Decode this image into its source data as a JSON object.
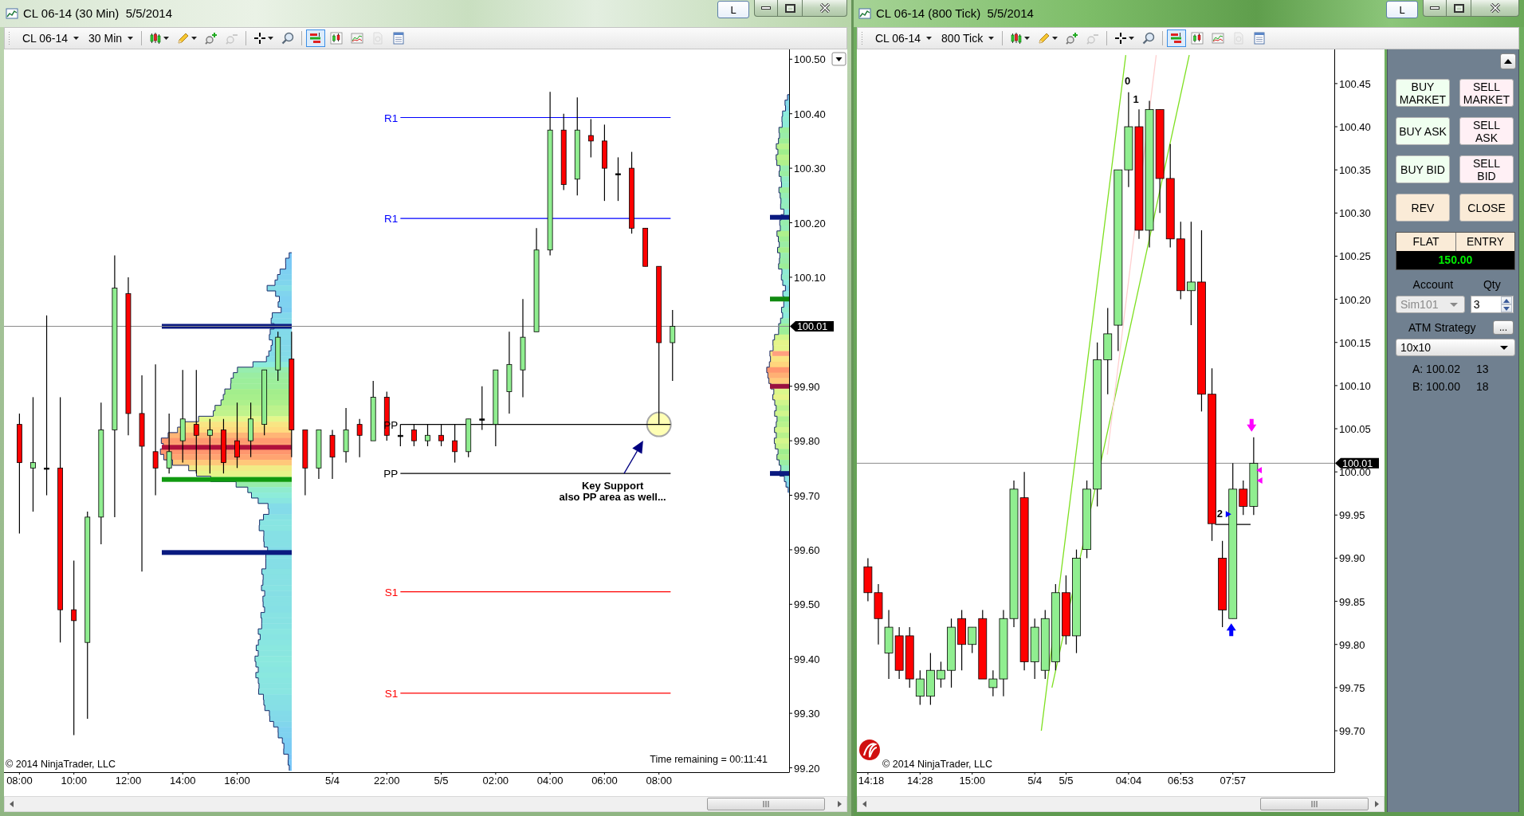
{
  "windows": [
    {
      "title": "CL 06-14 (30 Min)  5/5/2014",
      "link_button": "L",
      "toolbar": {
        "instrument": "CL 06-14",
        "interval": "30 Min",
        "tool_groups": [
          [
            {
              "kind": "bar-type",
              "dropdown": true,
              "selected": false,
              "disabled": false
            },
            {
              "kind": "draw",
              "dropdown": true,
              "selected": false,
              "disabled": false
            },
            {
              "kind": "zoom-in",
              "dropdown": false,
              "selected": false,
              "disabled": false
            },
            {
              "kind": "zoom-out",
              "dropdown": false,
              "selected": false,
              "disabled": true
            }
          ],
          [
            {
              "kind": "crosshair",
              "dropdown": true,
              "selected": false,
              "disabled": false
            },
            {
              "kind": "magnifier",
              "dropdown": false,
              "selected": false,
              "disabled": false
            }
          ],
          [
            {
              "kind": "chart-trader",
              "dropdown": false,
              "selected": true,
              "disabled": false
            },
            {
              "kind": "indicators",
              "dropdown": false,
              "selected": false,
              "disabled": false
            },
            {
              "kind": "strategies",
              "dropdown": false,
              "selected": false,
              "disabled": false
            },
            {
              "kind": "page",
              "dropdown": false,
              "selected": false,
              "disabled": true
            },
            {
              "kind": "properties",
              "dropdown": false,
              "selected": false,
              "disabled": false
            }
          ]
        ]
      },
      "chart": {
        "volume_profile": true,
        "mini_profile": true,
        "axis_menu_button": true,
        "last_price": "100.01",
        "copyright": {
          "text": "© 2014 NinjaTrader, LLC"
        },
        "time_remaining": "Time remaining = 00:11:41",
        "drawings": [
          {
            "kind": "circle"
          },
          {
            "kind": "arrow"
          }
        ],
        "chart_data": {
          "type": "candlestick",
          "categories": [
            "08:00",
            null,
            null,
            null,
            "10:00",
            null,
            null,
            null,
            "12:00",
            null,
            null,
            null,
            "14:00",
            null,
            null,
            null,
            "16:00",
            null,
            null,
            null,
            null,
            null,
            null,
            "5/4",
            null,
            null,
            null,
            "22:00",
            null,
            null,
            null,
            "5/5",
            null,
            null,
            null,
            "02:00",
            null,
            null,
            null,
            "04:00",
            null,
            null,
            null,
            "06:00",
            null,
            null,
            null,
            "08:00",
            null,
            null,
            null,
            null,
            null,
            null,
            null,
            null,
            null
          ],
          "ylim": [
            99.192,
            100.518
          ],
          "yticks": [
            {
              "value": 100.5,
              "label": "100.50"
            },
            {
              "value": 100.4,
              "label": "100.40"
            },
            {
              "value": 100.3,
              "label": "100.30"
            },
            {
              "value": 100.2,
              "label": "100.20"
            },
            {
              "value": 100.1,
              "label": "100.10"
            },
            {
              "value": 99.9,
              "label": "99.90"
            },
            {
              "value": 99.8,
              "label": "99.80"
            },
            {
              "value": 99.7,
              "label": "99.70"
            },
            {
              "value": 99.6,
              "label": "99.60"
            },
            {
              "value": 99.5,
              "label": "99.50"
            },
            {
              "value": 99.4,
              "label": "99.40"
            },
            {
              "value": 99.3,
              "label": "99.30"
            },
            {
              "value": 99.2,
              "label": "99.20"
            }
          ],
          "ohlc": [
            [
              99.83,
              99.85,
              99.63,
              99.76
            ],
            [
              99.75,
              99.88,
              99.67,
              99.76
            ],
            [
              99.75,
              100.03,
              99.7,
              99.75
            ],
            [
              99.75,
              99.88,
              99.43,
              99.49
            ],
            [
              99.49,
              99.58,
              99.26,
              99.47
            ],
            [
              99.43,
              99.67,
              99.29,
              99.66
            ],
            [
              99.66,
              99.87,
              99.61,
              99.82
            ],
            [
              99.82,
              100.14,
              99.66,
              100.08
            ],
            [
              100.07,
              100.1,
              99.81,
              99.85
            ],
            [
              99.85,
              99.92,
              99.56,
              99.79
            ],
            [
              99.78,
              99.94,
              99.7,
              99.75
            ],
            [
              99.75,
              99.85,
              99.74,
              99.78
            ],
            [
              99.8,
              99.93,
              99.76,
              99.84
            ],
            [
              99.83,
              99.93,
              99.74,
              99.81
            ],
            [
              99.81,
              99.84,
              99.74,
              99.82
            ],
            [
              99.82,
              99.84,
              99.74,
              99.76
            ],
            [
              99.8,
              99.87,
              99.75,
              99.77
            ],
            [
              99.8,
              99.87,
              99.77,
              99.84
            ],
            [
              99.83,
              99.93,
              99.81,
              99.93
            ],
            [
              99.93,
              100.0,
              99.91,
              99.99
            ],
            [
              99.95,
              100.0,
              99.77,
              99.82
            ],
            [
              99.82,
              99.82,
              99.7,
              99.75
            ],
            [
              99.75,
              99.82,
              99.73,
              99.82
            ],
            [
              99.81,
              99.82,
              99.73,
              99.77
            ],
            [
              99.78,
              99.86,
              99.76,
              99.82
            ],
            [
              99.83,
              99.84,
              99.77,
              99.81
            ],
            [
              99.8,
              99.91,
              99.8,
              99.88
            ],
            [
              99.88,
              99.89,
              99.8,
              99.81
            ],
            [
              99.81,
              99.83,
              99.79,
              99.81
            ],
            [
              99.82,
              99.83,
              99.79,
              99.8
            ],
            [
              99.8,
              99.83,
              99.79,
              99.81
            ],
            [
              99.81,
              99.83,
              99.79,
              99.8
            ],
            [
              99.8,
              99.83,
              99.76,
              99.78
            ],
            [
              99.78,
              99.84,
              99.77,
              99.84
            ],
            [
              99.84,
              99.9,
              99.82,
              99.84
            ],
            [
              99.83,
              99.93,
              99.79,
              99.93
            ],
            [
              99.89,
              100.0,
              99.85,
              99.94
            ],
            [
              99.93,
              100.06,
              99.88,
              99.99
            ],
            [
              100.0,
              100.19,
              100.0,
              100.15
            ],
            [
              100.15,
              100.44,
              100.14,
              100.37
            ],
            [
              100.37,
              100.4,
              100.26,
              100.27
            ],
            [
              100.28,
              100.43,
              100.25,
              100.37
            ],
            [
              100.36,
              100.39,
              100.32,
              100.35
            ],
            [
              100.35,
              100.38,
              100.24,
              100.3
            ],
            [
              100.29,
              100.32,
              100.24,
              100.29
            ],
            [
              100.3,
              100.33,
              100.18,
              100.19
            ],
            [
              100.19,
              100.19,
              100.12,
              100.12
            ],
            [
              100.12,
              100.12,
              99.83,
              99.98
            ],
            [
              99.98,
              100.04,
              99.91,
              100.01
            ],
            null,
            null,
            null,
            null,
            null,
            null,
            null,
            null
          ],
          "ref_lines": [
            {
              "axis": "y",
              "value": 100.393,
              "label": "R1",
              "color": "#0000ff"
            },
            {
              "axis": "y",
              "value": 100.208,
              "label": "R1",
              "color": "#0000ff"
            },
            {
              "axis": "y",
              "value": 99.83,
              "label": "PP",
              "color": "#000000"
            },
            {
              "axis": "y",
              "value": 99.74,
              "label": "PP",
              "color": "#000000"
            },
            {
              "axis": "y",
              "value": 99.523,
              "label": "S1",
              "color": "#ff0000"
            },
            {
              "axis": "y",
              "value": 99.337,
              "label": "S1",
              "color": "#ff0000"
            }
          ],
          "annotations": [
            "Key Support\nalso PP area as well..."
          ]
        }
      }
    },
    {
      "title": "CL 06-14 (800 Tick)  5/5/2014",
      "link_button": "L",
      "toolbar": {
        "instrument": "CL 06-14",
        "interval": "800 Tick",
        "tool_groups": [
          [
            {
              "kind": "bar-type",
              "dropdown": true,
              "selected": false,
              "disabled": false
            },
            {
              "kind": "draw",
              "dropdown": true,
              "selected": false,
              "disabled": false
            },
            {
              "kind": "zoom-in",
              "dropdown": false,
              "selected": false,
              "disabled": false
            },
            {
              "kind": "zoom-out",
              "dropdown": false,
              "selected": false,
              "disabled": true
            }
          ],
          [
            {
              "kind": "crosshair",
              "dropdown": true,
              "selected": false,
              "disabled": false
            },
            {
              "kind": "magnifier",
              "dropdown": false,
              "selected": false,
              "disabled": false
            }
          ],
          [
            {
              "kind": "chart-trader",
              "dropdown": false,
              "selected": true,
              "disabled": false
            },
            {
              "kind": "indicators",
              "dropdown": false,
              "selected": false,
              "disabled": false
            },
            {
              "kind": "strategies",
              "dropdown": false,
              "selected": false,
              "disabled": false
            },
            {
              "kind": "page",
              "dropdown": false,
              "selected": false,
              "disabled": true
            },
            {
              "kind": "properties",
              "dropdown": false,
              "selected": false,
              "disabled": false
            }
          ]
        ]
      },
      "chart": {
        "last_price": "100.01",
        "copyright": {
          "text": "© 2014 NinjaTrader, LLC",
          "logo": true
        },
        "drawings": [
          {
            "kind": "trendline",
            "color": "#7ee020"
          },
          {
            "kind": "trendline",
            "color": "#7ee020"
          },
          {
            "kind": "trendline",
            "color": "#ffd0d0"
          },
          {
            "kind": "segment"
          },
          {
            "kind": "triangle-right",
            "color": "#0000ff"
          },
          {
            "kind": "arrow-down",
            "color": "#ff00ff"
          },
          {
            "kind": "arrow-up",
            "color": "#0000ff"
          },
          {
            "kind": "triangle-left",
            "color": "#ff00ff"
          },
          {
            "kind": "triangle-left",
            "color": "#ff00ff"
          }
        ],
        "chart_data": {
          "type": "candlestick",
          "categories": [
            "14:18",
            null,
            null,
            null,
            null,
            "14:28",
            null,
            null,
            null,
            null,
            "15:00",
            null,
            null,
            null,
            null,
            null,
            "5/4",
            null,
            null,
            "5/5",
            null,
            null,
            null,
            null,
            null,
            "04:04",
            null,
            null,
            null,
            null,
            "06:53",
            null,
            null,
            null,
            null,
            "07:57",
            null,
            null,
            null,
            null,
            null,
            null,
            null,
            null,
            null
          ],
          "ylim": [
            99.652,
            100.4896
          ],
          "yticks": [
            {
              "value": 100.45,
              "label": "100.45"
            },
            {
              "value": 100.4,
              "label": "100.40"
            },
            {
              "value": 100.35,
              "label": "100.35"
            },
            {
              "value": 100.3,
              "label": "100.30"
            },
            {
              "value": 100.25,
              "label": "100.25"
            },
            {
              "value": 100.2,
              "label": "100.20"
            },
            {
              "value": 100.15,
              "label": "100.15"
            },
            {
              "value": 100.1,
              "label": "100.10"
            },
            {
              "value": 100.05,
              "label": "100.05"
            },
            {
              "value": 100.0,
              "label": "100.00"
            },
            {
              "value": 99.95,
              "label": "99.95"
            },
            {
              "value": 99.9,
              "label": "99.90"
            },
            {
              "value": 99.85,
              "label": "99.85"
            },
            {
              "value": 99.8,
              "label": "99.80"
            },
            {
              "value": 99.75,
              "label": "99.75"
            },
            {
              "value": 99.7,
              "label": "99.70"
            }
          ],
          "ohlc": [
            [
              99.89,
              99.9,
              99.85,
              99.86
            ],
            [
              99.86,
              99.87,
              99.8,
              99.83
            ],
            [
              99.79,
              99.84,
              99.76,
              99.82
            ],
            [
              99.81,
              99.82,
              99.76,
              99.77
            ],
            [
              99.81,
              99.82,
              99.75,
              99.76
            ],
            [
              99.74,
              99.77,
              99.73,
              99.76
            ],
            [
              99.74,
              99.79,
              99.73,
              99.77
            ],
            [
              99.76,
              99.78,
              99.75,
              99.77
            ],
            [
              99.77,
              99.83,
              99.75,
              99.82
            ],
            [
              99.83,
              99.84,
              99.77,
              99.8
            ],
            [
              99.8,
              99.82,
              99.79,
              99.82
            ],
            [
              99.83,
              99.84,
              99.76,
              99.76
            ],
            [
              99.75,
              99.77,
              99.74,
              99.76
            ],
            [
              99.76,
              99.84,
              99.74,
              99.83
            ],
            [
              99.83,
              99.99,
              99.82,
              99.98
            ],
            [
              99.97,
              100.0,
              99.77,
              99.78
            ],
            [
              99.78,
              99.83,
              99.76,
              99.82
            ],
            [
              99.77,
              99.84,
              99.76,
              99.83
            ],
            [
              99.78,
              99.87,
              99.77,
              99.86
            ],
            [
              99.86,
              99.88,
              99.8,
              99.81
            ],
            [
              99.81,
              99.91,
              99.79,
              99.9
            ],
            [
              99.91,
              99.99,
              99.9,
              99.98
            ],
            [
              99.98,
              100.15,
              99.96,
              100.13
            ],
            [
              100.13,
              100.19,
              100.09,
              100.16
            ],
            [
              100.17,
              100.35,
              100.14,
              100.35
            ],
            [
              100.35,
              100.44,
              100.33,
              100.4
            ],
            [
              100.4,
              100.42,
              100.27,
              100.28
            ],
            [
              100.28,
              100.43,
              100.26,
              100.42
            ],
            [
              100.42,
              100.42,
              100.3,
              100.34
            ],
            [
              100.34,
              100.38,
              100.26,
              100.27
            ],
            [
              100.27,
              100.29,
              100.2,
              100.21
            ],
            [
              100.21,
              100.29,
              100.17,
              100.22
            ],
            [
              100.22,
              100.28,
              100.07,
              100.09
            ],
            [
              100.09,
              100.12,
              99.92,
              99.94
            ],
            [
              99.9,
              99.92,
              99.82,
              99.84
            ],
            [
              99.83,
              100.01,
              99.83,
              99.98
            ],
            [
              99.98,
              99.99,
              99.95,
              99.96
            ],
            [
              99.96,
              100.04,
              99.95,
              100.01
            ],
            null,
            null,
            null,
            null,
            null,
            null,
            null
          ],
          "annotations": [
            "0",
            "1",
            "2"
          ]
        }
      },
      "order_panel": {
        "buttons": [
          {
            "label": "BUY\nMARKET",
            "kind": "buy"
          },
          {
            "label": "SELL\nMARKET",
            "kind": "sell"
          },
          {
            "label": "BUY ASK",
            "kind": "buy"
          },
          {
            "label": "SELL\nASK",
            "kind": "sell"
          },
          {
            "label": "BUY BID",
            "kind": "buy"
          },
          {
            "label": "SELL\nBID",
            "kind": "sell"
          },
          {
            "label": "REV",
            "kind": "neutral"
          },
          {
            "label": "CLOSE",
            "kind": "neutral"
          }
        ],
        "position": {
          "status": "FLAT",
          "entry": "ENTRY",
          "pnl": "150.00"
        },
        "account": {
          "label": "Account",
          "value": "Sim101",
          "disabled": true
        },
        "quantity": {
          "label": "Qty",
          "value": "3"
        },
        "atm_strategy": {
          "label": "ATM Strategy",
          "more_button": "...",
          "value": "10x10"
        },
        "quotes": [
          {
            "text": "A: 100.02",
            "size": "13"
          },
          {
            "text": "B: 100.00",
            "size": "18"
          }
        ]
      }
    }
  ]
}
